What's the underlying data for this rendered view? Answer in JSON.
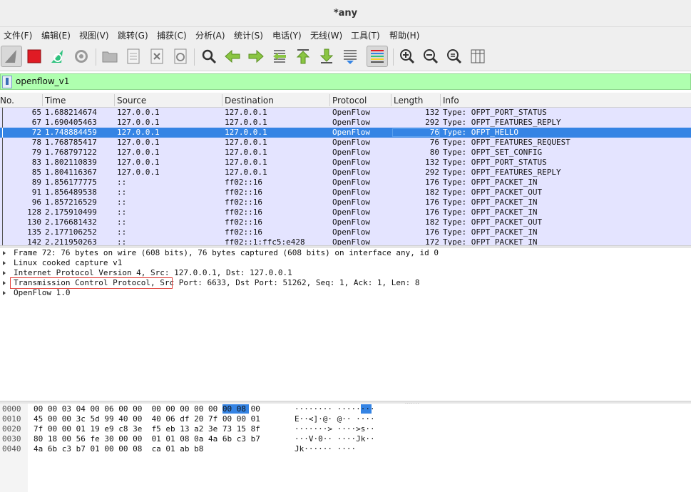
{
  "window": {
    "title": "*any"
  },
  "menu": [
    "文件(F)",
    "编辑(E)",
    "视图(V)",
    "跳转(G)",
    "捕获(C)",
    "分析(A)",
    "统计(S)",
    "电话(Y)",
    "无线(W)",
    "工具(T)",
    "帮助(H)"
  ],
  "filter": {
    "value": "openflow_v1"
  },
  "columns": {
    "no": "No.",
    "time": "Time",
    "source": "Source",
    "destination": "Destination",
    "protocol": "Protocol",
    "length": "Length",
    "info": "Info"
  },
  "packets": [
    {
      "no": "65",
      "time": "1.688214674",
      "source": "127.0.0.1",
      "destination": "127.0.0.1",
      "protocol": "OpenFlow",
      "length": "132",
      "info": "Type: OFPT_PORT_STATUS"
    },
    {
      "no": "67",
      "time": "1.690405463",
      "source": "127.0.0.1",
      "destination": "127.0.0.1",
      "protocol": "OpenFlow",
      "length": "292",
      "info": "Type: OFPT_FEATURES_REPLY"
    },
    {
      "no": "72",
      "time": "1.748884459",
      "source": "127.0.0.1",
      "destination": "127.0.0.1",
      "protocol": "OpenFlow",
      "length": "76",
      "info": "Type: OFPT_HELLO",
      "selected": true
    },
    {
      "no": "78",
      "time": "1.768785417",
      "source": "127.0.0.1",
      "destination": "127.0.0.1",
      "protocol": "OpenFlow",
      "length": "76",
      "info": "Type: OFPT_FEATURES_REQUEST"
    },
    {
      "no": "79",
      "time": "1.768797122",
      "source": "127.0.0.1",
      "destination": "127.0.0.1",
      "protocol": "OpenFlow",
      "length": "80",
      "info": "Type: OFPT_SET_CONFIG"
    },
    {
      "no": "83",
      "time": "1.802110839",
      "source": "127.0.0.1",
      "destination": "127.0.0.1",
      "protocol": "OpenFlow",
      "length": "132",
      "info": "Type: OFPT_PORT_STATUS"
    },
    {
      "no": "85",
      "time": "1.804116367",
      "source": "127.0.0.1",
      "destination": "127.0.0.1",
      "protocol": "OpenFlow",
      "length": "292",
      "info": "Type: OFPT_FEATURES_REPLY"
    },
    {
      "no": "89",
      "time": "1.856177775",
      "source": "::",
      "destination": "ff02::16",
      "protocol": "OpenFlow",
      "length": "176",
      "info": "Type: OFPT_PACKET_IN"
    },
    {
      "no": "91",
      "time": "1.856489538",
      "source": "::",
      "destination": "ff02::16",
      "protocol": "OpenFlow",
      "length": "182",
      "info": "Type: OFPT_PACKET_OUT"
    },
    {
      "no": "96",
      "time": "1.857216529",
      "source": "::",
      "destination": "ff02::16",
      "protocol": "OpenFlow",
      "length": "176",
      "info": "Type: OFPT_PACKET_IN"
    },
    {
      "no": "128",
      "time": "2.175910499",
      "source": "::",
      "destination": "ff02::16",
      "protocol": "OpenFlow",
      "length": "176",
      "info": "Type: OFPT_PACKET_IN"
    },
    {
      "no": "130",
      "time": "2.176681432",
      "source": "::",
      "destination": "ff02::16",
      "protocol": "OpenFlow",
      "length": "182",
      "info": "Type: OFPT_PACKET_OUT"
    },
    {
      "no": "135",
      "time": "2.177106252",
      "source": "::",
      "destination": "ff02::16",
      "protocol": "OpenFlow",
      "length": "176",
      "info": "Type: OFPT_PACKET_IN"
    },
    {
      "no": "142",
      "time": "2.211950263",
      "source": "::",
      "destination": "ff02::1:ffc5:e428",
      "protocol": "OpenFlow",
      "length": "172",
      "info": "Type: OFPT_PACKET_IN"
    }
  ],
  "details": [
    "Frame 72: 76 bytes on wire (608 bits), 76 bytes captured (608 bits) on interface any, id 0",
    "Linux cooked capture v1",
    "Internet Protocol Version 4, Src: 127.0.0.1, Dst: 127.0.0.1",
    "Transmission Control Protocol, Src Port: 6633, Dst Port: 51262, Seq: 1, Ack: 1, Len: 8",
    "OpenFlow 1.0"
  ],
  "bytes": [
    {
      "offset": "0000",
      "hex": "00 00 03 04 00 06 00 00  00 00 00 00 00 00 08 00",
      "ascii": "········ ········"
    },
    {
      "offset": "0010",
      "hex": "45 00 00 3c 5d 99 40 00  40 06 df 20 7f 00 00 01",
      "ascii": "E··<]·@· @·· ····"
    },
    {
      "offset": "0020",
      "hex": "7f 00 00 01 19 e9 c8 3e  f5 eb 13 a2 3e 73 15 8f",
      "ascii": "·······> ····>s··"
    },
    {
      "offset": "0030",
      "hex": "80 18 00 56 fe 30 00 00  01 01 08 0a 4a 6b c3 b7",
      "ascii": "···V·0·· ····Jk··"
    },
    {
      "offset": "0040",
      "hex": "4a 6b c3 b7 01 00 00 08  ca 01 ab b8",
      "ascii": "Jk······ ····"
    }
  ],
  "colors": {
    "selection": "#3584e4",
    "filter_bg": "#afffaf",
    "row_bg": "#e4e4ff"
  }
}
